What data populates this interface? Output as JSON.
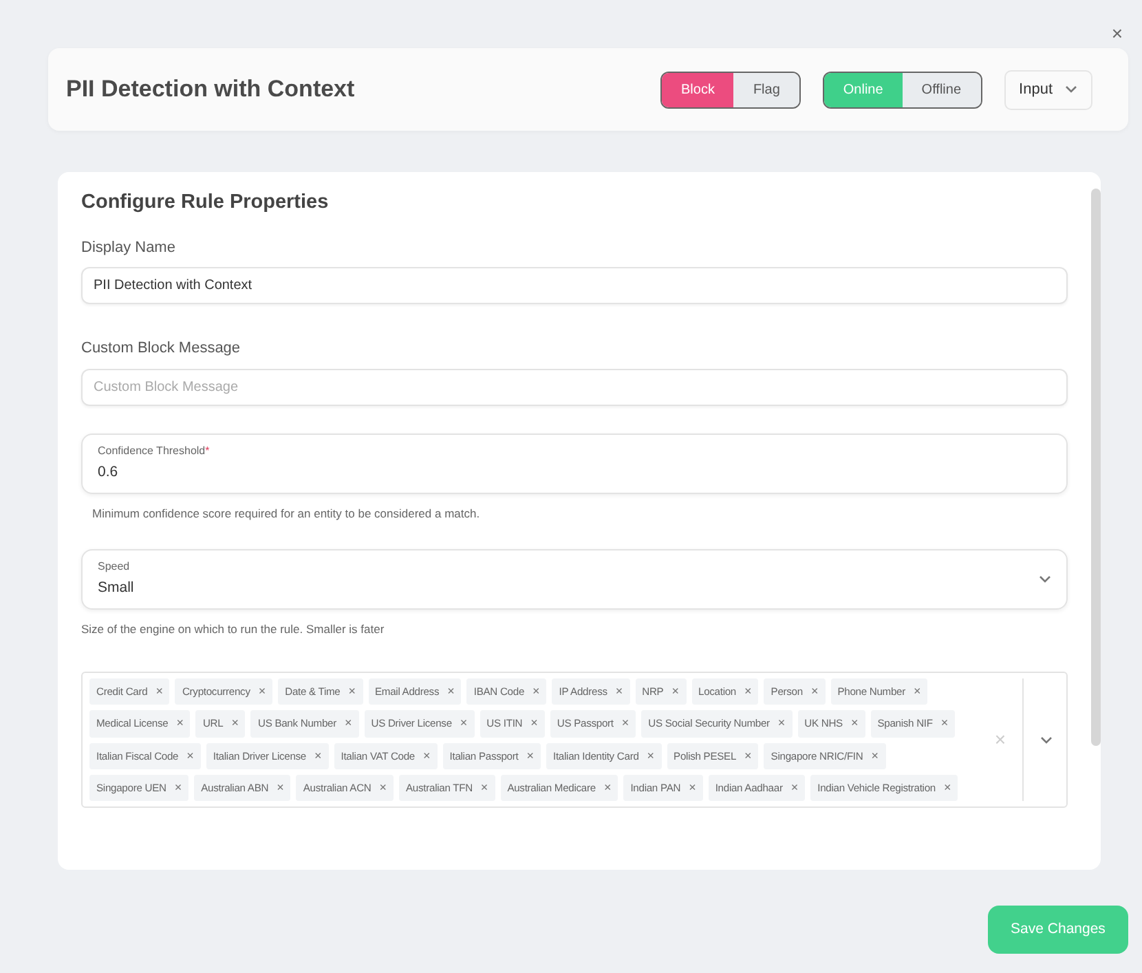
{
  "close_label": "×",
  "header": {
    "title": "PII Detection with Context",
    "action_toggle": [
      {
        "label": "Block",
        "selected": true
      },
      {
        "label": "Flag",
        "selected": false
      }
    ],
    "mode_toggle": [
      {
        "label": "Online",
        "selected": true
      },
      {
        "label": "Offline",
        "selected": false
      }
    ],
    "direction_select": {
      "value": "Input"
    }
  },
  "form": {
    "title": "Configure Rule Properties",
    "display_name": {
      "label": "Display Name",
      "value": "PII Detection with Context"
    },
    "block_message": {
      "label": "Custom Block Message",
      "placeholder": "Custom Block Message"
    },
    "confidence": {
      "label": "Confidence Threshold",
      "required_mark": "*",
      "value": "0.6",
      "help": "Minimum confidence score required for an entity to be considered a match."
    },
    "speed": {
      "label": "Speed",
      "value": "Small",
      "help": "Size of the engine on which to run the rule. Smaller is fater"
    },
    "entities": {
      "clear_label": "×",
      "tags": [
        {
          "label": "Credit Card",
          "remove": "×"
        },
        {
          "label": "Cryptocurrency",
          "remove": "×"
        },
        {
          "label": "Date & Time",
          "remove": "×"
        },
        {
          "label": "Email Address",
          "remove": "×"
        },
        {
          "label": "IBAN Code",
          "remove": "×"
        },
        {
          "label": "IP Address",
          "remove": "×"
        },
        {
          "label": "NRP",
          "remove": "×"
        },
        {
          "label": "Location",
          "remove": "×"
        },
        {
          "label": "Person",
          "remove": "×"
        },
        {
          "label": "Phone Number",
          "remove": "×"
        },
        {
          "label": "Medical License",
          "remove": "×"
        },
        {
          "label": "URL",
          "remove": "×"
        },
        {
          "label": "US Bank Number",
          "remove": "×"
        },
        {
          "label": "US Driver License",
          "remove": "×"
        },
        {
          "label": "US ITIN",
          "remove": "×"
        },
        {
          "label": "US Passport",
          "remove": "×"
        },
        {
          "label": "US Social Security Number",
          "remove": "×"
        },
        {
          "label": "UK NHS",
          "remove": "×"
        },
        {
          "label": "Spanish NIF",
          "remove": "×"
        },
        {
          "label": "Italian Fiscal Code",
          "remove": "×"
        },
        {
          "label": "Italian Driver License",
          "remove": "×"
        },
        {
          "label": "Italian VAT Code",
          "remove": "×"
        },
        {
          "label": "Italian Passport",
          "remove": "×"
        },
        {
          "label": "Italian Identity Card",
          "remove": "×"
        },
        {
          "label": "Polish PESEL",
          "remove": "×"
        },
        {
          "label": "Singapore NRIC/FIN",
          "remove": "×"
        },
        {
          "label": "Singapore UEN",
          "remove": "×"
        },
        {
          "label": "Australian ABN",
          "remove": "×"
        },
        {
          "label": "Australian ACN",
          "remove": "×"
        },
        {
          "label": "Australian TFN",
          "remove": "×"
        },
        {
          "label": "Australian Medicare",
          "remove": "×"
        },
        {
          "label": "Indian PAN",
          "remove": "×"
        },
        {
          "label": "Indian Aadhaar",
          "remove": "×"
        },
        {
          "label": "Indian Vehicle Registration",
          "remove": "×"
        }
      ]
    }
  },
  "save_button": "Save Changes"
}
